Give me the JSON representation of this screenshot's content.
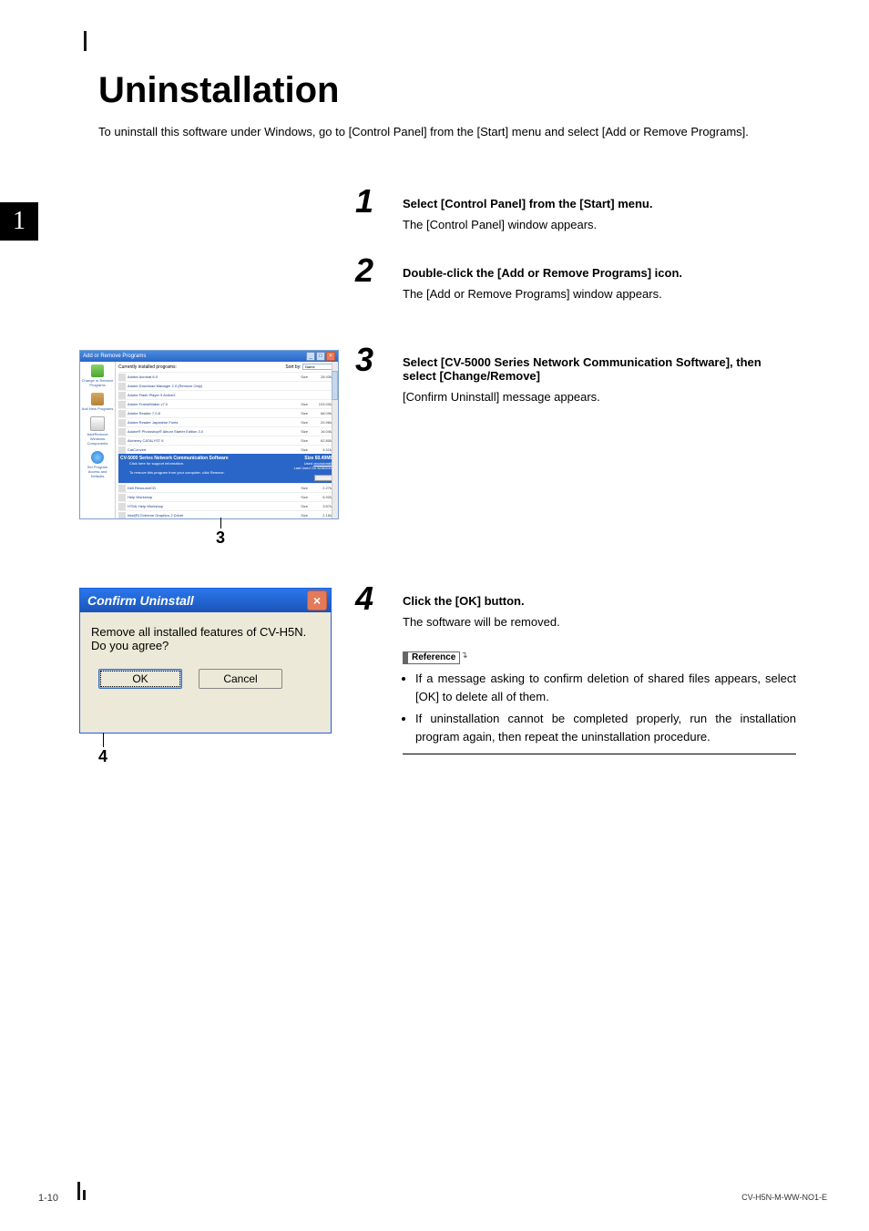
{
  "chapter_number": "1",
  "title": "Uninstallation",
  "intro": "To uninstall this software under Windows, go to [Control Panel] from the [Start] menu and select [Add or Remove Programs].",
  "steps": {
    "s1": {
      "num": "1",
      "bold": "Select [Control Panel] from the [Start] menu.",
      "body": "The [Control Panel] window appears."
    },
    "s2": {
      "num": "2",
      "bold": "Double-click the [Add or Remove Programs] icon.",
      "body": "The [Add or Remove Programs] window appears."
    },
    "s3": {
      "num": "3",
      "bold": "Select [CV-5000 Series Network Communication Software], then select [Change/Remove]",
      "body": "[Confirm Uninstall] message appears."
    },
    "s4": {
      "num": "4",
      "bold": "Click the [OK] button.",
      "body": "The software will be removed."
    }
  },
  "callouts": {
    "c3": "3",
    "c4": "4"
  },
  "reference": {
    "label": "Reference",
    "items": [
      "If a message asking to confirm deletion of shared files appears, select [OK] to delete all of them.",
      "If uninstallation cannot be completed properly, run the installation program again, then repeat the uninstallation procedure."
    ]
  },
  "shot1": {
    "title": "Add or Remove Programs",
    "header": "Currently installed programs:",
    "sort_label": "Sort by:",
    "sort_value": "Name",
    "side": [
      "Change or Remove Programs",
      "Add New Programs",
      "Add/Remove Windows Components",
      "Set Program Access and Defaults"
    ],
    "programs": [
      {
        "name": "Adobe Acrobat 8.0",
        "size": "28.93MB"
      },
      {
        "name": "Adobe Download Manager 2.0 (Remove Only)",
        "size": ""
      },
      {
        "name": "Adobe Flash Player 9 ActiveX",
        "size": ""
      },
      {
        "name": "Adobe FrameMaker v7.0",
        "size": "103.00MB"
      },
      {
        "name": "Adobe Reader 7.0.8",
        "size": "68.09MB"
      },
      {
        "name": "Adobe Reader Japanese Fonts",
        "size": "20.96MB"
      },
      {
        "name": "Adobe® Photoshop® Album Starter Edition 3.0",
        "size": "16.04MB"
      },
      {
        "name": "Alchemy CATALYST 6",
        "size": "62.80MB"
      },
      {
        "name": "CatConvert",
        "size": "4.41MB"
      }
    ],
    "selected": {
      "name": "CV-5000 Series Network Communication Software",
      "size": "60.49MB",
      "support": "Click here for support information.",
      "used_label": "Used",
      "used_value": "occasionally",
      "lastused_label": "Last Used On",
      "lastused_value": "9/26/2008",
      "remove_desc": "To remove this program from your computer, click Remove.",
      "remove_btn": "Remove"
    },
    "after": [
      {
        "name": "Dell ResourceCD",
        "size": "2.27MB"
      },
      {
        "name": "Help Workshop",
        "size": "6.92MB"
      },
      {
        "name": "HTML Help Workshop",
        "size": "3.87MB"
      },
      {
        "name": "Intel(R) Extreme Graphics 2 Driver",
        "size": "2.16MB"
      }
    ]
  },
  "shot2": {
    "title": "Confirm Uninstall",
    "message": "Remove all installed features of CV-H5N. Do you agree?",
    "ok": "OK",
    "cancel": "Cancel"
  },
  "footer": {
    "page": "1-10",
    "docid": "CV-H5N-M-WW-NO1-E"
  }
}
